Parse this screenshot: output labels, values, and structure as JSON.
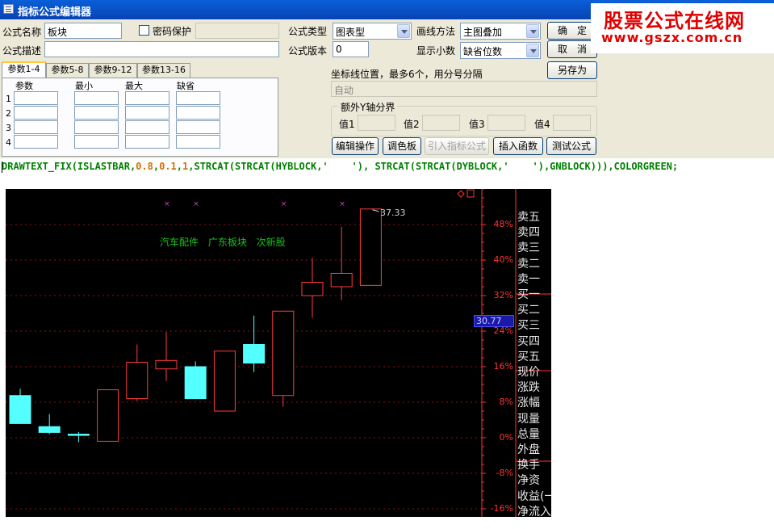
{
  "window": {
    "title": "指标公式编辑器"
  },
  "watermark": {
    "line1": "股票公式在线网",
    "line2": "www.gszx.com.cn"
  },
  "form": {
    "name_label": "公式名称",
    "name_value": "板块",
    "password_label": "密码保护",
    "password_checked": false,
    "desc_label": "公式描述",
    "desc_value": "",
    "type_label": "公式类型",
    "type_value": "图表型",
    "method_label": "画线方法",
    "method_value": "主图叠加",
    "version_label": "公式版本",
    "version_value": "0",
    "decimals_label": "显示小数",
    "decimals_value": "缺省位数"
  },
  "buttons": {
    "ok": "确　定",
    "cancel": "取　消",
    "save_as": "另存为",
    "edit_op": "编辑操作",
    "palette": "调色板",
    "import": "引入指标公式",
    "insert_fn": "插入函数",
    "test": "测试公式"
  },
  "tabs": [
    "参数1-4",
    "参数5-8",
    "参数9-12",
    "参数13-16"
  ],
  "params": {
    "headers": [
      "参数",
      "最小",
      "最大",
      "缺省"
    ],
    "rows": [
      "1",
      "2",
      "3",
      "4"
    ]
  },
  "axis_line": {
    "label": "坐标线位置，最多6个，用分号分隔",
    "value": "自动"
  },
  "extra_axis": {
    "title": "额外Y轴分界",
    "labels": [
      "值1",
      "值2",
      "值3",
      "值4"
    ]
  },
  "formula": {
    "text_pre1": "DRAWTEXT_FIX(ISLASTBAR,",
    "n1": "0.8",
    "sep1": ",",
    "n2": "0.1",
    "sep2": ",",
    "n3": "1",
    "text_post": ",STRCAT(STRCAT(HYBLOCK,'    '), STRCAT(STRCAT(DYBLOCK,'    '),GNBLOCK))),COLORGREEN;"
  },
  "chart": {
    "stock_text": "汽车配件 广东板块 次新股",
    "peak_label": "37.33",
    "price_tag": "30.77",
    "axis_ticks": [
      "48%",
      "40%",
      "32%",
      "24%",
      "16%",
      "8%",
      "0%",
      "-8%",
      "-16%"
    ],
    "side_labels": [
      "卖五",
      "卖四",
      "卖三",
      "卖二",
      "卖一",
      "买一",
      "买二",
      "买三",
      "买四",
      "买五",
      "现价",
      "涨跌",
      "涨幅",
      "现量",
      "总量",
      "外盘",
      "换手",
      "净资",
      "收益(一",
      "净流入"
    ],
    "colors": {
      "up": "#ff3c3c",
      "down": "#54ffff",
      "text": "#19c319",
      "background": "#000000"
    }
  },
  "chart_data": {
    "type": "candlestick",
    "y_unit": "percent change",
    "y_ticks": [
      48,
      40,
      32,
      24,
      16,
      8,
      0,
      -8,
      -16
    ],
    "candles": [
      {
        "open": 9.5,
        "close": 3.2,
        "high": 11.0,
        "low": 3.2
      },
      {
        "open": 2.5,
        "close": 1.2,
        "high": 5.3,
        "low": 0.8
      },
      {
        "open": 0.8,
        "close": 0.6,
        "high": 1.3,
        "low": -1.0
      },
      {
        "open": -0.8,
        "close": 10.8,
        "high": 10.8,
        "low": -0.8
      },
      {
        "open": 8.8,
        "close": 17.0,
        "high": 21.0,
        "low": 8.3
      },
      {
        "open": 15.5,
        "close": 17.4,
        "high": 23.8,
        "low": 12.8
      },
      {
        "open": 16.0,
        "close": 8.8,
        "high": 17.2,
        "low": 8.8
      },
      {
        "open": 6.0,
        "close": 19.5,
        "high": 19.5,
        "low": 6.0
      },
      {
        "open": 21.0,
        "close": 16.8,
        "high": 27.5,
        "low": 14.8
      },
      {
        "open": 9.5,
        "close": 28.5,
        "high": 28.5,
        "low": 7.0
      },
      {
        "open": 32.0,
        "close": 35.0,
        "high": 40.5,
        "low": 27.0
      },
      {
        "open": 34.0,
        "close": 37.0,
        "high": 47.5,
        "low": 31.0
      },
      {
        "open": 34.3,
        "close": 51.5,
        "high": 51.5,
        "low": 34.3
      }
    ],
    "markers_above_candles": [
      5,
      6,
      9,
      11
    ]
  }
}
